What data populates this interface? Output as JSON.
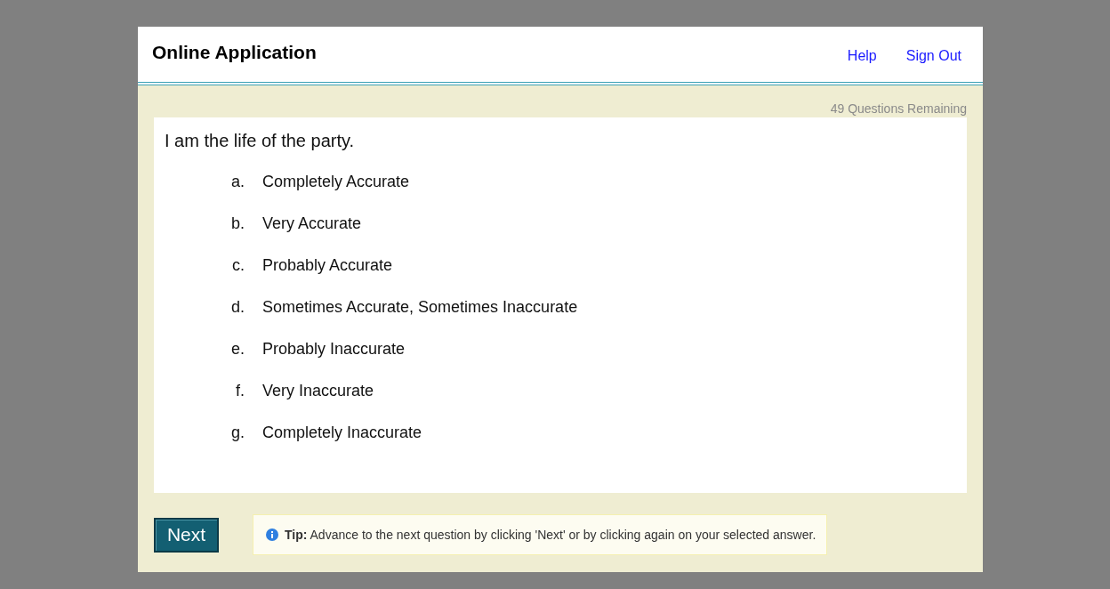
{
  "header": {
    "title": "Online Application",
    "links": [
      "Help",
      "Sign Out"
    ]
  },
  "remaining": "49 Questions Remaining",
  "question": "I am the life of the party.",
  "options": [
    {
      "letter": "a.",
      "label": "Completely Accurate"
    },
    {
      "letter": "b.",
      "label": "Very Accurate"
    },
    {
      "letter": "c.",
      "label": "Probably Accurate"
    },
    {
      "letter": "d.",
      "label": "Sometimes Accurate, Sometimes Inaccurate"
    },
    {
      "letter": "e.",
      "label": "Probably Inaccurate"
    },
    {
      "letter": "f.",
      "label": "Very Inaccurate"
    },
    {
      "letter": "g.",
      "label": "Completely Inaccurate"
    }
  ],
  "next_button": "Next",
  "tip": "**Tip:** Advance to the next question by clicking 'Next' or by clicking again on your selected answer."
}
